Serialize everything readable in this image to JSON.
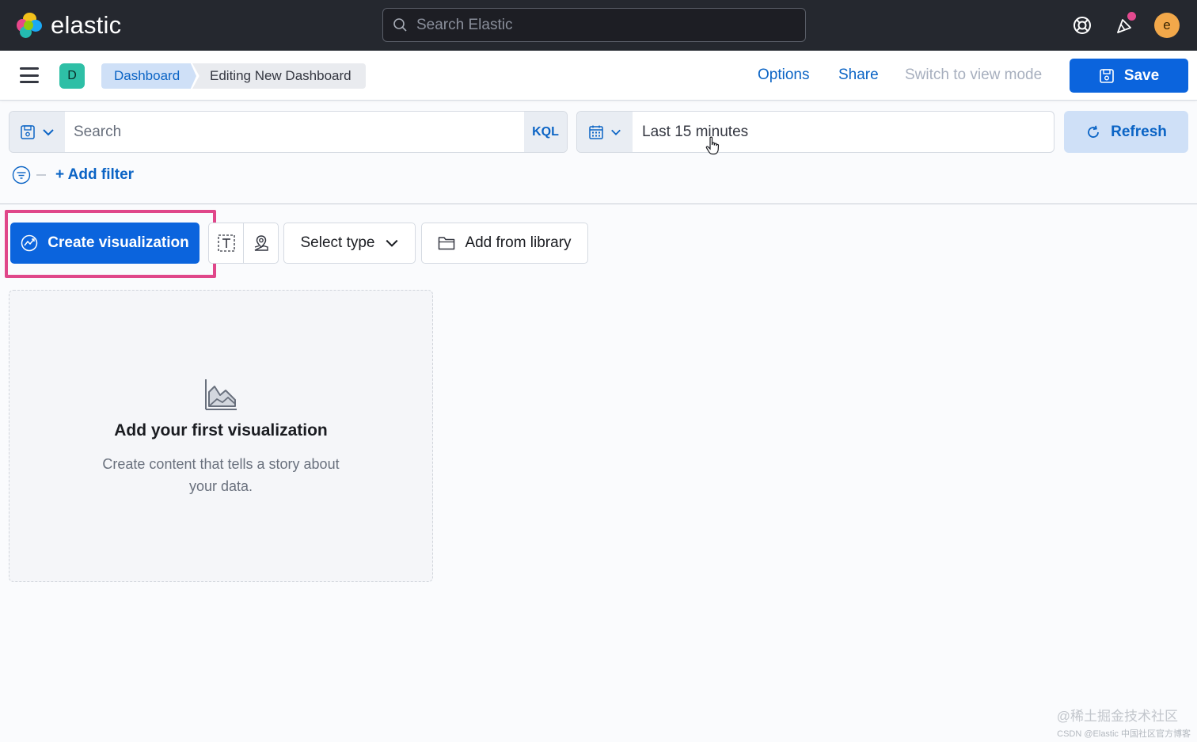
{
  "header": {
    "logo_text": "elastic",
    "search_placeholder": "Search Elastic",
    "avatar_initial": "e",
    "colors": {
      "background": "#25282f",
      "notification_dot": "#e34a8f",
      "avatar": "#f2a84a"
    },
    "icons": [
      "help-icon",
      "news-feed-icon"
    ]
  },
  "navbar": {
    "space_initial": "D",
    "breadcrumbs": [
      {
        "label": "Dashboard"
      },
      {
        "label": "Editing New Dashboard"
      }
    ],
    "options_label": "Options",
    "share_label": "Share",
    "view_mode_label": "Switch to view mode",
    "save_label": "Save",
    "colors": {
      "primary": "#0b64dd",
      "space_badge": "#2ebfa6"
    }
  },
  "query_bar": {
    "search_placeholder": "Search",
    "language_label": "KQL",
    "time_range": "Last 15 minutes",
    "refresh_label": "Refresh",
    "add_filter_label": "+ Add filter"
  },
  "toolbar": {
    "create_label": "Create visualization",
    "select_type_label": "Select type",
    "add_library_label": "Add from library",
    "highlight_color": "#e0478a"
  },
  "empty_state": {
    "title": "Add your first visualization",
    "description": "Create content that tells a story about your data."
  },
  "watermark": {
    "line1": "@稀土掘金技术社区",
    "line2": "CSDN @Elastic 中国社区官方博客"
  }
}
